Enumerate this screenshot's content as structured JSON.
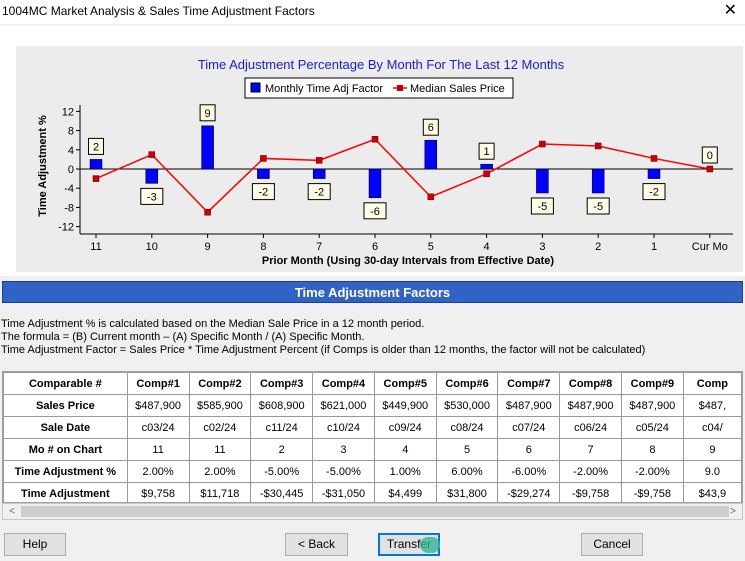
{
  "window": {
    "title": "1004MC Market Analysis & Sales Time Adjustment Factors",
    "close_glyph": "✕"
  },
  "chart_data": {
    "type": "bar",
    "title": "Time Adjustment Percentage By Month For The Last 12 Months",
    "xlabel": "Prior Month (Using 30-day Intervals from Effective Date)",
    "ylabel": "Time Adjustment %",
    "ylim": [
      -13,
      13
    ],
    "yticks": [
      12,
      8,
      4,
      0,
      -4,
      -8,
      -12
    ],
    "categories": [
      "11",
      "10",
      "9",
      "8",
      "7",
      "6",
      "5",
      "4",
      "3",
      "2",
      "1",
      "Cur Mo"
    ],
    "series": [
      {
        "name": "Monthly Time Adj Factor",
        "kind": "bar",
        "color": "#0000ff",
        "values": [
          2,
          -3,
          9,
          -2,
          -2,
          -6,
          6,
          1,
          -5,
          -5,
          -2,
          0
        ]
      },
      {
        "name": "Median Sales Price",
        "kind": "line",
        "color": "#ff0000",
        "values": [
          -2,
          3,
          -9,
          2.2,
          1.8,
          6.2,
          -5.8,
          -1,
          5.2,
          4.8,
          2.2,
          0
        ]
      }
    ],
    "legend": "top-center",
    "grid": false
  },
  "section_title": "Time Adjustment Factors",
  "notes": [
    "Time Adjustment % is calculated based on the Median Sale Price in a 12 month period.",
    "The formula = (B) Current month – (A) Specific Month / (A) Specific Month.",
    "Time Adjustment Factor = Sales Price * Time Adjustment Percent (if Comps is older than 12 months, the factor will not be calculated)"
  ],
  "table": {
    "corner": "Comparable #",
    "columns": [
      "Comp#1",
      "Comp#2",
      "Comp#3",
      "Comp#4",
      "Comp#5",
      "Comp#6",
      "Comp#7",
      "Comp#8",
      "Comp#9",
      "Comp"
    ],
    "rows": [
      {
        "label": "Sales Price",
        "cells": [
          "$487,900",
          "$585,900",
          "$608,900",
          "$621,000",
          "$449,900",
          "$530,000",
          "$487,900",
          "$487,900",
          "$487,900",
          "$487,"
        ]
      },
      {
        "label": "Sale Date",
        "cells": [
          "c03/24",
          "c02/24",
          "c11/24",
          "c10/24",
          "c09/24",
          "c08/24",
          "c07/24",
          "c06/24",
          "c05/24",
          "c04/"
        ]
      },
      {
        "label": "Mo # on Chart",
        "cells": [
          "11",
          "11",
          "2",
          "3",
          "4",
          "5",
          "6",
          "7",
          "8",
          "9"
        ]
      },
      {
        "label": "Time Adjustment %",
        "cells": [
          "2.00%",
          "2.00%",
          "-5.00%",
          "-5.00%",
          "1.00%",
          "6.00%",
          "-6.00%",
          "-2.00%",
          "-2.00%",
          "9.0"
        ]
      },
      {
        "label": "Time Adjustment",
        "cells": [
          "$9,758",
          "$11,718",
          "-$30,445",
          "-$31,050",
          "$4,499",
          "$31,800",
          "-$29,274",
          "-$9,758",
          "-$9,758",
          "$43,9"
        ]
      }
    ]
  },
  "scrollbar": {
    "left_glyph": "<",
    "right_glyph": ">"
  },
  "buttons": {
    "help": "Help",
    "back": "< Back",
    "transfer": "Transfer",
    "cancel": "Cancel"
  }
}
